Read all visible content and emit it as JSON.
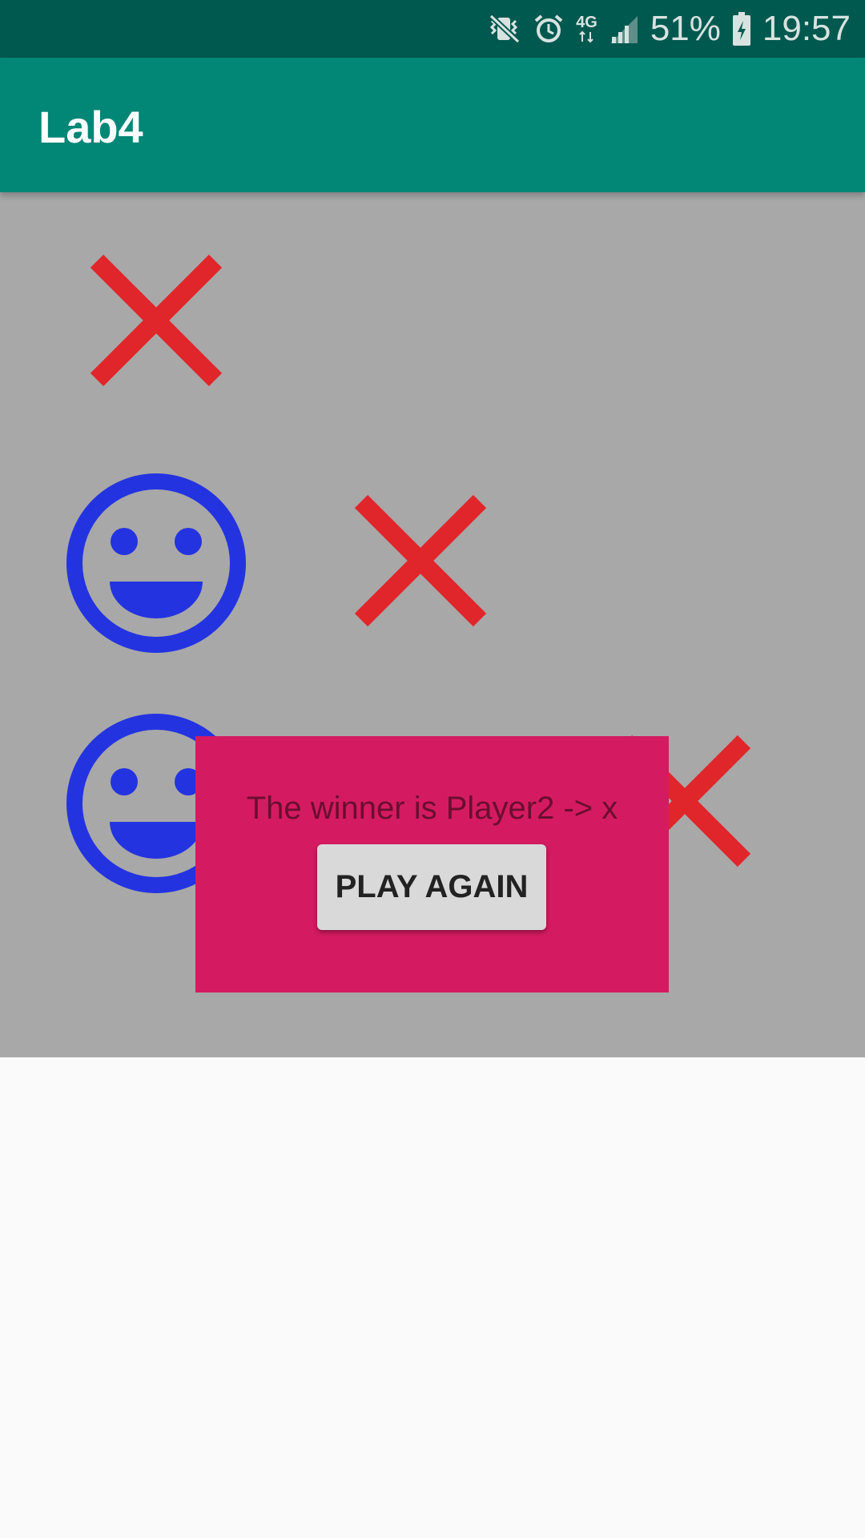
{
  "status_bar": {
    "battery_percent": "51%",
    "time": "19:57",
    "network_label": "4G",
    "icons": [
      "mute-vibrate-icon",
      "alarm-icon",
      "network-4g-icon",
      "signal-icon",
      "battery-charging-icon"
    ]
  },
  "app_bar": {
    "title": "Lab4"
  },
  "board": {
    "cells": [
      {
        "row": 0,
        "col": 0,
        "mark": "x"
      },
      {
        "row": 0,
        "col": 1,
        "mark": ""
      },
      {
        "row": 0,
        "col": 2,
        "mark": ""
      },
      {
        "row": 1,
        "col": 0,
        "mark": "smiley"
      },
      {
        "row": 1,
        "col": 1,
        "mark": "x"
      },
      {
        "row": 1,
        "col": 2,
        "mark": ""
      },
      {
        "row": 2,
        "col": 0,
        "mark": "smiley"
      },
      {
        "row": 2,
        "col": 1,
        "mark": ""
      },
      {
        "row": 2,
        "col": 2,
        "mark": "x"
      }
    ]
  },
  "dialog": {
    "message": "The winner is Player2 -> x",
    "button_label": "PLAY AGAIN"
  },
  "colors": {
    "status_bar": "#00594f",
    "app_bar": "#028676",
    "board_dim": "#a8a8a8",
    "x_mark": "#e0262a",
    "smiley": "#2433e0",
    "dialog": "#d41b61",
    "button": "#d9d9d9"
  }
}
